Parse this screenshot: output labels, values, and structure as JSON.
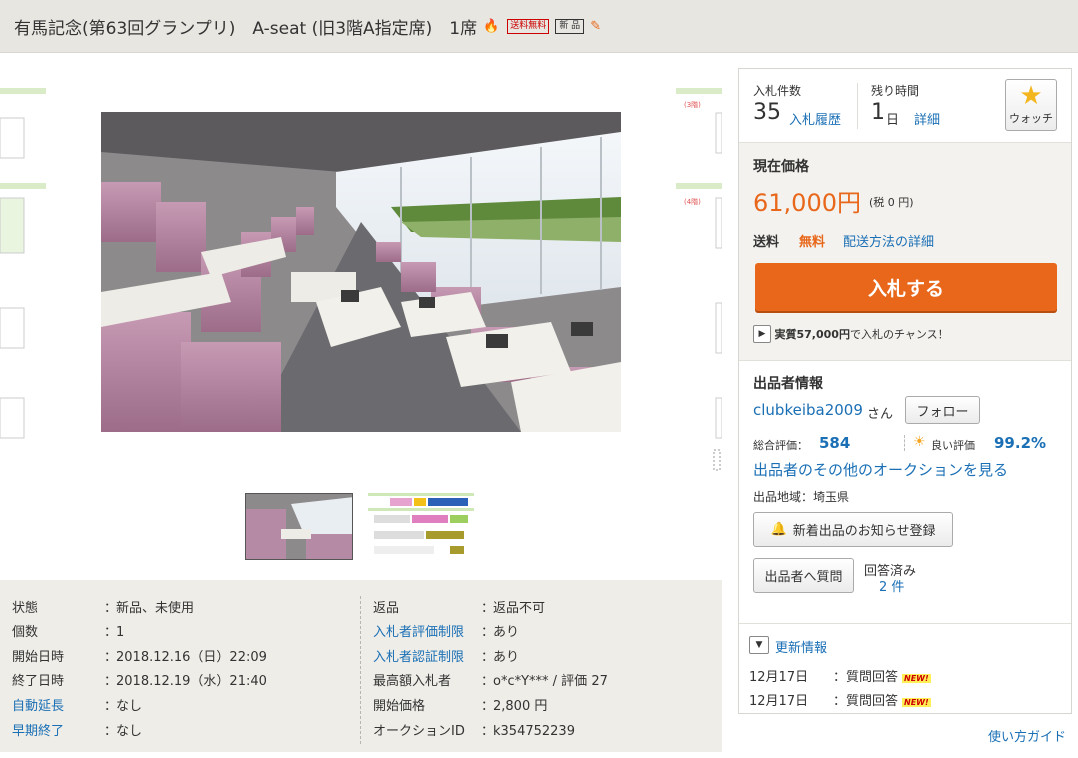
{
  "header": {
    "title": "有馬記念(第63回グランプリ)　A-seat (旧3階A指定席)　1席",
    "badge_free_shipping": "送料無料",
    "badge_new": "新 品"
  },
  "images": {
    "side_labels": [
      "(3階)",
      "(4階)"
    ],
    "thumbnail_count": 2
  },
  "details": {
    "left": [
      {
        "label": "状態",
        "value": "新品、未使用",
        "link": false
      },
      {
        "label": "個数",
        "value": "1",
        "link": false
      },
      {
        "label": "開始日時",
        "value": "2018.12.16（日）22:09",
        "link": false
      },
      {
        "label": "終了日時",
        "value": "2018.12.19（水）21:40",
        "link": false
      },
      {
        "label": "自動延長",
        "value": "なし",
        "link": true
      },
      {
        "label": "早期終了",
        "value": "なし",
        "link": true
      }
    ],
    "right": [
      {
        "label": "返品",
        "value": "返品不可",
        "link": false
      },
      {
        "label": "入札者評価制限",
        "value": "あり",
        "link": true
      },
      {
        "label": "入札者認証制限",
        "value": "あり",
        "link": true
      },
      {
        "label": "最高額入札者",
        "value": "o*c*Y*** / 評価 27",
        "link": false
      },
      {
        "label": "開始価格",
        "value": "2,800 円",
        "link": false
      },
      {
        "label": "オークションID",
        "value": "k354752239",
        "link": false
      }
    ],
    "separator": "："
  },
  "bid": {
    "count_label": "入札件数",
    "count_value": "35",
    "history_link": "入札履歴",
    "time_label": "残り時間",
    "time_value": "1",
    "time_unit": "日",
    "detail_link": "詳細",
    "watch_label": "ウォッチ"
  },
  "price": {
    "label": "現在価格",
    "value": "61,000円",
    "tax": "(税 0 円)",
    "shipping_label": "送料",
    "shipping_value": "無料",
    "shipping_link": "配送方法の詳細",
    "bid_button": "入札する",
    "chance_amount": "実質57,000円",
    "chance_text": "で入札のチャンス！"
  },
  "seller": {
    "heading": "出品者情報",
    "name": "clubkeiba2009",
    "name_suffix": "さん",
    "follow": "フォロー",
    "rating_label": "総合評価：",
    "rating_value": "584",
    "good_label": "良い評価",
    "good_value": "99.2%",
    "other_auctions": "出品者のその他のオークションを見る",
    "region": "出品地域：埼玉県",
    "notify_button": "新着出品のお知らせ登録",
    "question_button": "出品者へ質問",
    "answered_label": "回答済み",
    "answered_count": "2 件"
  },
  "updates": {
    "heading": "更新情報",
    "items": [
      {
        "date": "12月17日",
        "text": "：質問回答",
        "tag": "NEW!"
      },
      {
        "date": "12月17日",
        "text": "：質問回答",
        "tag": "NEW!"
      }
    ]
  },
  "footer": {
    "guide": "使い方ガイド"
  },
  "colors": {
    "price": "#e8671a",
    "link": "#1a6fb5",
    "bid_button": "#e8671a"
  }
}
